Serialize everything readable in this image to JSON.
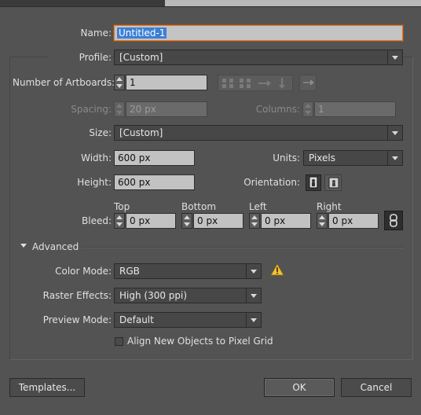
{
  "document": {
    "name_label": "Name:",
    "name_value": "Untitled-1",
    "profile_label": "Profile:",
    "profile_value": "[Custom]",
    "artboards_label": "Number of Artboards:",
    "artboards_value": "1",
    "spacing_label": "Spacing:",
    "spacing_value": "20 px",
    "columns_label": "Columns:",
    "columns_value": "1",
    "size_label": "Size:",
    "size_value": "[Custom]",
    "width_label": "Width:",
    "width_value": "600 px",
    "units_label": "Units:",
    "units_value": "Pixels",
    "height_label": "Height:",
    "height_value": "600 px",
    "orientation_label": "Orientation:",
    "bleed_label": "Bleed:",
    "bleed": [
      {
        "label": "Top",
        "value": "0 px"
      },
      {
        "label": "Bottom",
        "value": "0 px"
      },
      {
        "label": "Left",
        "value": "0 px"
      },
      {
        "label": "Right",
        "value": "0 px"
      }
    ]
  },
  "advanced": {
    "toggle_label": "Advanced",
    "color_mode_label": "Color Mode:",
    "color_mode_value": "RGB",
    "raster_label": "Raster Effects:",
    "raster_value": "High (300 ppi)",
    "preview_label": "Preview Mode:",
    "preview_value": "Default",
    "align_label": "Align New Objects to Pixel Grid"
  },
  "buttons": {
    "templates": "Templates...",
    "ok": "OK",
    "cancel": "Cancel"
  },
  "colors": {
    "dialog_bg": "#535353",
    "focus_ring": "#e07b30",
    "selection": "#3d7fd6",
    "warning": "#f2c230"
  }
}
